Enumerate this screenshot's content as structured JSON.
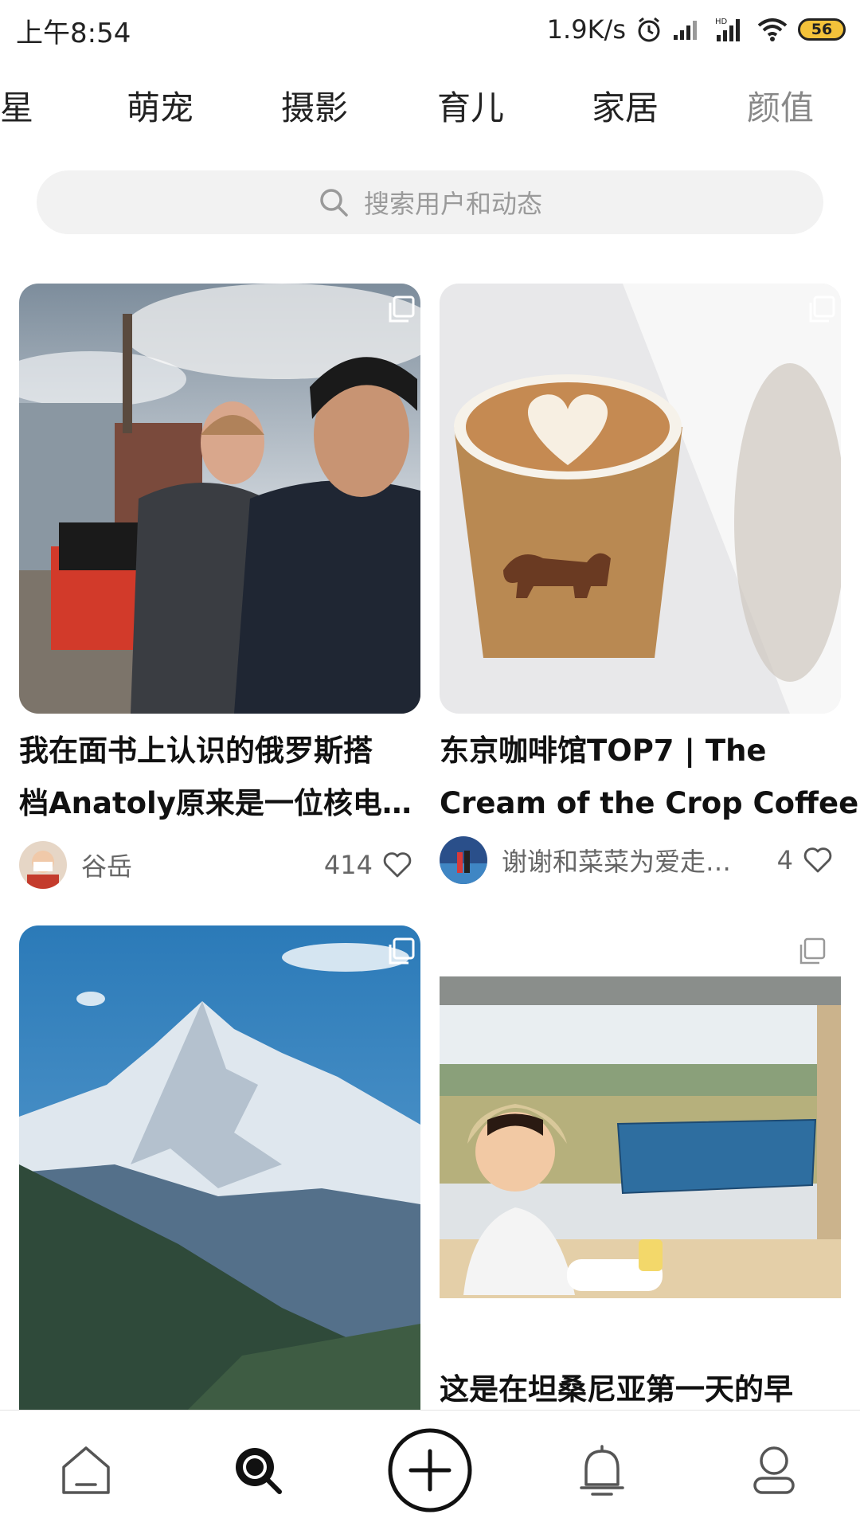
{
  "status": {
    "time": "上午8:54",
    "net_speed": "1.9K/s",
    "battery": "56"
  },
  "tabs": [
    "明星",
    "萌宠",
    "摄影",
    "育儿",
    "家居",
    "颜值"
  ],
  "search": {
    "placeholder": "搜索用户和动态"
  },
  "cards": [
    {
      "title_lines": [
        "我在面书上认识的俄罗斯搭",
        "档Anatoly原来是一位核电…"
      ],
      "author": "谷岳",
      "likes": "414"
    },
    {
      "title_lines": [
        "东京咖啡馆TOP7 | The",
        "Cream of the Crop Coffee…"
      ],
      "author": "谢谢和菜菜为爱走…",
      "likes": "4"
    },
    {
      "title_lines": [],
      "author": "",
      "likes": ""
    },
    {
      "title_lines": [
        "这是在坦桑尼亚第一天的早"
      ],
      "author": "",
      "likes": ""
    }
  ],
  "colors": {
    "battery": "#f3c23a",
    "text": "#111111",
    "muted": "#666666"
  },
  "icons": [
    "alarm-icon",
    "signal-icon",
    "wifi-icon",
    "battery-icon",
    "search-icon",
    "multi-image-icon",
    "heart-icon",
    "home-icon",
    "discover-icon",
    "add-icon",
    "bell-icon",
    "profile-icon"
  ]
}
